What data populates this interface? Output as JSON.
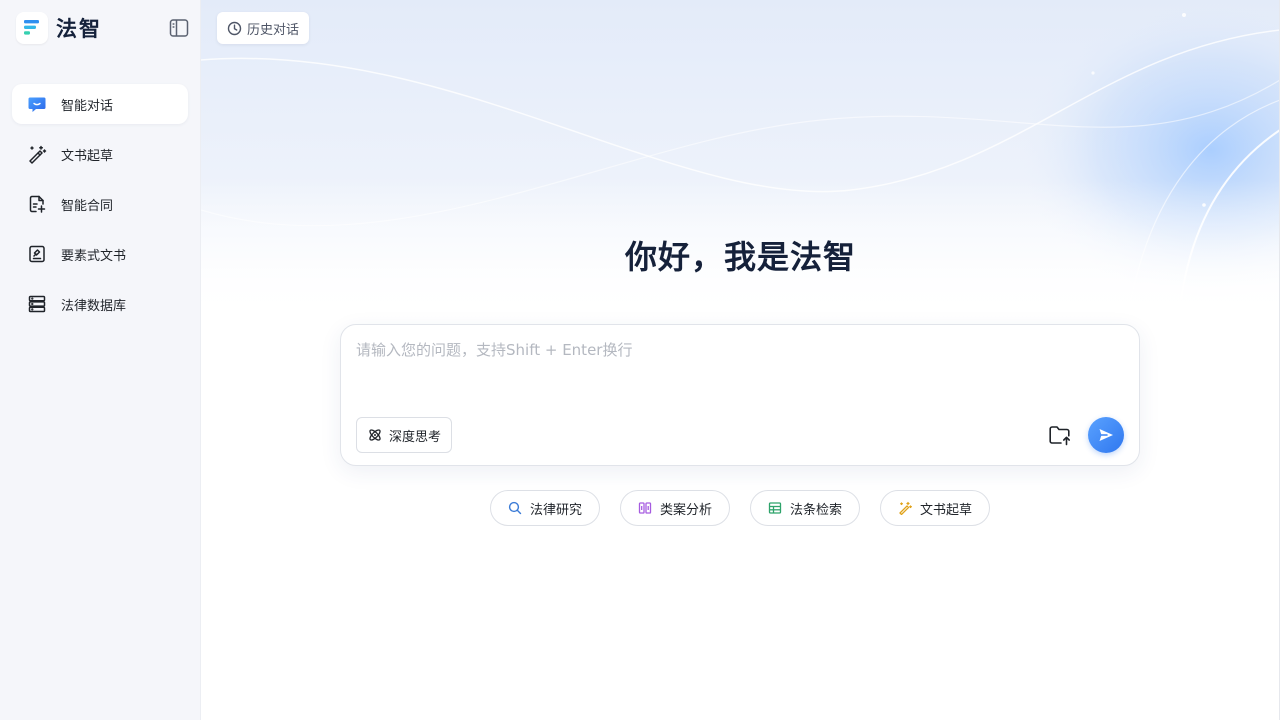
{
  "brand": {
    "name": "法智"
  },
  "sidebar": {
    "items": [
      {
        "label": "智能对话",
        "icon": "chat-bubble-icon",
        "active": true
      },
      {
        "label": "文书起草",
        "icon": "magic-pen-icon"
      },
      {
        "label": "智能合同",
        "icon": "contract-icon"
      },
      {
        "label": "要素式文书",
        "icon": "element-doc-icon"
      },
      {
        "label": "法律数据库",
        "icon": "database-icon"
      }
    ]
  },
  "header": {
    "history_label": "历史对话"
  },
  "main": {
    "greeting": "你好，我是法智",
    "input_placeholder": "请输入您的问题，支持Shift + Enter换行",
    "deep_think_label": "深度思考",
    "chips": [
      {
        "label": "法律研究",
        "color": "#3b7bd6"
      },
      {
        "label": "类案分析",
        "color": "#a65ce0"
      },
      {
        "label": "法条检索",
        "color": "#2fa36b"
      },
      {
        "label": "文书起草",
        "color": "#e0a21a"
      }
    ]
  },
  "colors": {
    "accent": "#2f77ef",
    "sidebar_bg": "#f5f6fa",
    "title": "#15213a"
  }
}
